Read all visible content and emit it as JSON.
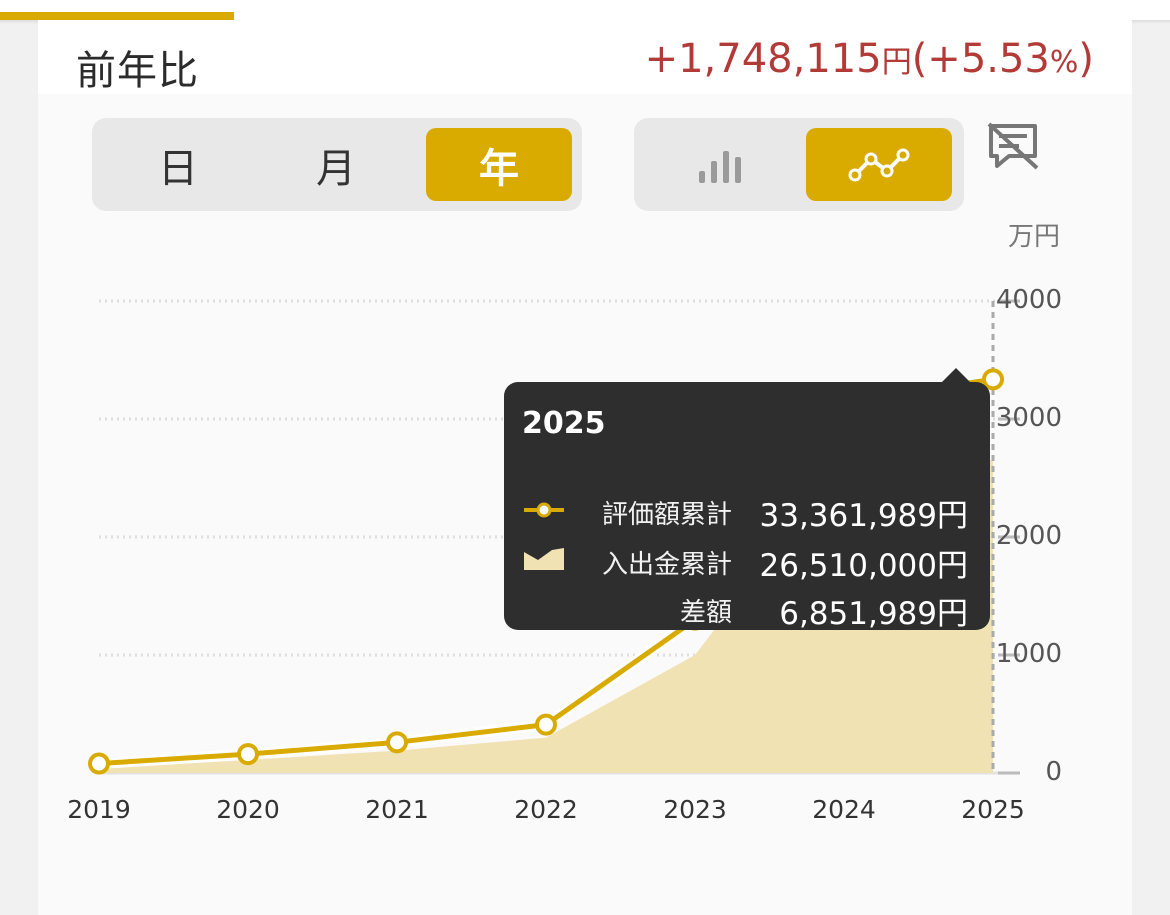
{
  "header": {
    "title": "前年比",
    "change_amount": "+1,748,115",
    "change_unit": "円",
    "change_open": "(",
    "change_percent": "+5.53",
    "percent_sign": "%",
    "change_close": ")"
  },
  "period_tabs": [
    {
      "label": "日",
      "active": false
    },
    {
      "label": "月",
      "active": false
    },
    {
      "label": "年",
      "active": true
    }
  ],
  "chart_type_toggle": {
    "options": [
      "bar-chart-icon",
      "line-chart-icon"
    ],
    "active": "line-chart-icon"
  },
  "hide_chart_icon": "chart-off-icon",
  "colors": {
    "accent": "#d9ab00",
    "deposit_fill": "#f0e2b2",
    "negative": "#b23a37",
    "tooltip_bg": "#2e2e2e"
  },
  "chart_data": {
    "type": "line",
    "unit": "万円",
    "x": [
      "2019",
      "2020",
      "2021",
      "2022",
      "2023",
      "2024",
      "2025"
    ],
    "yticks": [
      "0",
      "1000",
      "2000",
      "3000",
      "4000"
    ],
    "ylim": [
      0,
      4000
    ],
    "series": [
      {
        "name": "評価額累計",
        "kind": "line",
        "values": [
          80,
          160,
          260,
          410,
          1300,
          3150,
          3336.1989
        ]
      },
      {
        "name": "入出金累計",
        "kind": "area",
        "values": [
          40,
          110,
          190,
          300,
          1000,
          2650,
          2651
        ]
      }
    ],
    "grid": true,
    "tooltip": {
      "title": "2025",
      "rows": [
        {
          "label": "評価額累計",
          "value": "33,361,989円"
        },
        {
          "label": "入出金累計",
          "value": "26,510,000円"
        },
        {
          "label": "差額",
          "value": "6,851,989円"
        }
      ]
    }
  }
}
